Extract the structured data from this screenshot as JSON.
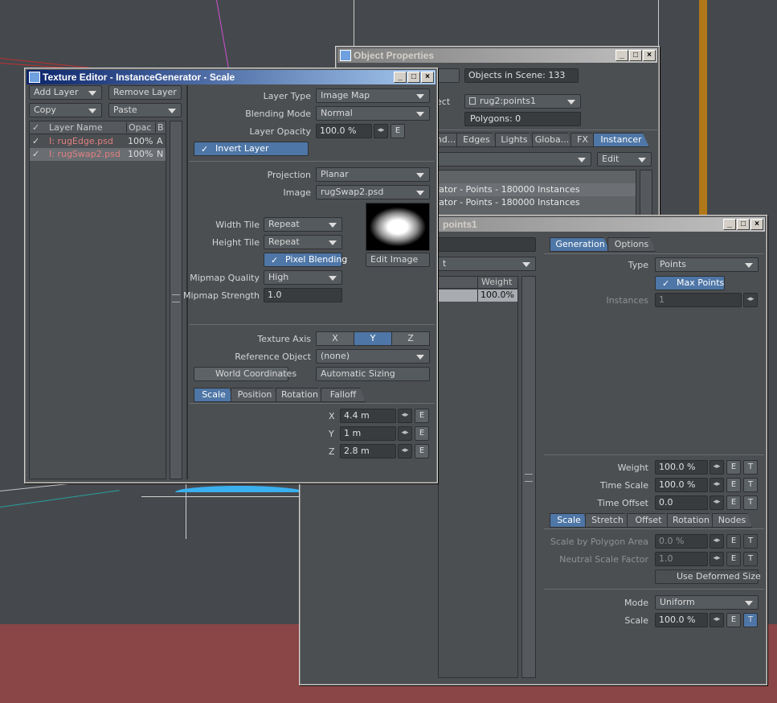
{
  "object_properties": {
    "title": "Object Properties",
    "objects_in_scene": "Objects in Scene: 133",
    "object_label": "bject",
    "object_value": "rug2:points1",
    "polygons": "Polygons: 0",
    "tabs": [
      "nd...",
      "Edges",
      "Lights",
      "Globa...",
      "FX",
      "Instancer"
    ],
    "active_tab": "Instancer",
    "edit_label": "Edit",
    "instance_rows": [
      "erator - Points - 180000 Instances",
      "erator - Points - 180000 Instances"
    ]
  },
  "instancer": {
    "title": "points1",
    "tabs": [
      "Generation",
      "Options"
    ],
    "list_header_weight": "Weight",
    "list_row_weight": "100.0%",
    "partial_dropdown": "t",
    "type_label": "Type",
    "type_value": "Points",
    "max_points_label": "Max Points",
    "instances_label": "Instances",
    "instances_value": "1",
    "weight_label": "Weight",
    "weight_value": "100.0 %",
    "time_scale_label": "Time Scale",
    "time_scale_value": "100.0 %",
    "time_offset_label": "Time Offset",
    "time_offset_value": "0.0",
    "sub_tabs": [
      "Scale",
      "Stretch",
      "Offset",
      "Rotation",
      "Nodes"
    ],
    "scale_by_polygon_label": "Scale by Polygon Area",
    "scale_by_polygon_value": "0.0 %",
    "neutral_scale_label": "Neutral Scale Factor",
    "neutral_scale_value": "1.0",
    "use_deformed_label": "Use Deformed Size",
    "mode_label": "Mode",
    "mode_value": "Uniform",
    "scale_label": "Scale",
    "scale_value": "100.0 %",
    "e": "E",
    "t": "T"
  },
  "texture_editor": {
    "title": "Texture Editor - InstanceGenerator - Scale",
    "add_layer": "Add Layer",
    "remove_layer": "Remove Layer",
    "copy": "Copy",
    "paste": "Paste",
    "col_check": "✓",
    "col_name": "Layer Name",
    "col_opac": "Opac",
    "col_b": "B",
    "layers": [
      {
        "name": "I: rugEdge.psd",
        "opac": "100%",
        "b": "A"
      },
      {
        "name": "I: rugSwap2.psd",
        "opac": "100%",
        "b": "N"
      }
    ],
    "layer_type_label": "Layer Type",
    "layer_type_value": "Image Map",
    "blending_mode_label": "Blending Mode",
    "blending_mode_value": "Normal",
    "layer_opacity_label": "Layer Opacity",
    "layer_opacity_value": "100.0 %",
    "invert_layer": "Invert Layer",
    "projection_label": "Projection",
    "projection_value": "Planar",
    "image_label": "Image",
    "image_value": "rugSwap2.psd",
    "width_tile_label": "Width Tile",
    "width_tile_value": "Repeat",
    "height_tile_label": "Height Tile",
    "height_tile_value": "Repeat",
    "pixel_blending": "Pixel Blending",
    "edit_image": "Edit Image",
    "mipmap_quality_label": "Mipmap Quality",
    "mipmap_quality_value": "High",
    "mipmap_strength_label": "Mipmap Strength",
    "mipmap_strength_value": "1.0",
    "texture_axis_label": "Texture Axis",
    "axes": [
      "X",
      "Y",
      "Z"
    ],
    "active_axis": "Y",
    "reference_object_label": "Reference Object",
    "reference_object_value": "(none)",
    "world_coordinates": "World Coordinates",
    "automatic_sizing": "Automatic Sizing",
    "tabs": [
      "Scale",
      "Position",
      "Rotation",
      "Falloff"
    ],
    "x_label": "X",
    "x_value": "4.4 m",
    "y_label": "Y",
    "y_value": "1 m",
    "z_label": "Z",
    "z_value": "2.8 m",
    "e": "E"
  },
  "colors": {
    "accent": "#4e76a6",
    "titlebar": "#0a246a",
    "panel": "#4c4f52",
    "floor": "#8a4546",
    "layer_text": "#e08080"
  }
}
